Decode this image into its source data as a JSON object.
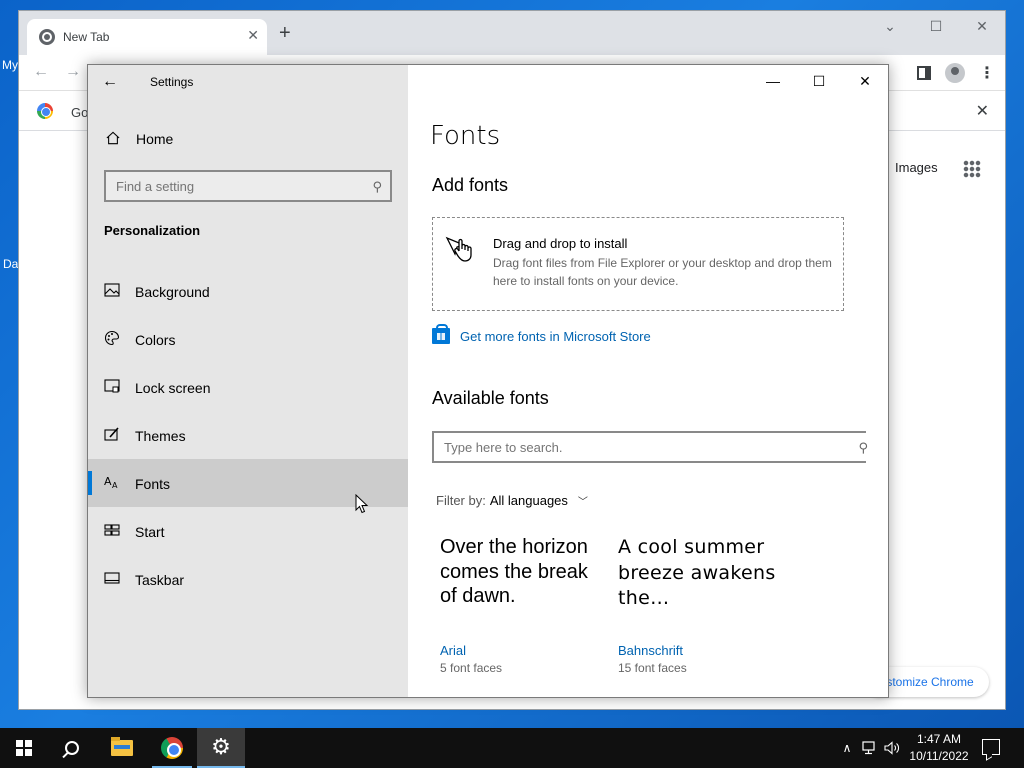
{
  "desktop": {
    "label_1": "My",
    "label_2": "Da"
  },
  "chrome": {
    "tab_title": "New Tab",
    "tab_close": "✕",
    "new_tab": "+",
    "min": "⌄",
    "restore": "☐",
    "close": "✕",
    "back": "←",
    "forward": "→",
    "menu": "⋮",
    "infobar_text": "Go",
    "infobar_close": "✕",
    "images_link": "Images",
    "customize_label": "ıstomize Chrome"
  },
  "settings": {
    "window_title": "Settings",
    "back": "←",
    "controls": {
      "minimize": "—",
      "maximize": "☐",
      "close": "✕"
    },
    "home_label": "Home",
    "search_placeholder": "Find a setting",
    "section_title": "Personalization",
    "nav": [
      {
        "label": "Background",
        "icon": "picture-icon"
      },
      {
        "label": "Colors",
        "icon": "palette-icon"
      },
      {
        "label": "Lock screen",
        "icon": "lock-screen-icon"
      },
      {
        "label": "Themes",
        "icon": "themes-icon"
      },
      {
        "label": "Fonts",
        "icon": "fonts-icon",
        "active": true
      },
      {
        "label": "Start",
        "icon": "start-icon"
      },
      {
        "label": "Taskbar",
        "icon": "taskbar-icon"
      }
    ],
    "content": {
      "title": "Fonts",
      "add_fonts_heading": "Add fonts",
      "drop_title": "Drag and drop to install",
      "drop_desc": "Drag font files from File Explorer or your desktop and drop them here to install fonts on your device.",
      "store_link": "Get more fonts in Microsoft Store",
      "available_heading": "Available fonts",
      "font_search_placeholder": "Type here to search.",
      "filter_label": "Filter by:",
      "filter_value": "All languages",
      "fonts": [
        {
          "sample": "Over the horizon comes the break of dawn.",
          "name": "Arial",
          "faces": "5 font faces"
        },
        {
          "sample": "A cool summer breeze awakens the…",
          "name": "Bahnschrift",
          "faces": "15 font faces"
        }
      ]
    }
  },
  "taskbar": {
    "time": "1:47 AM",
    "date": "10/11/2022",
    "tray_chevron": "∧"
  },
  "colors": {
    "accent": "#0078d7",
    "link": "#0063b1",
    "sidebar_bg": "#e6e6e6",
    "taskbar_bg": "#101010"
  }
}
